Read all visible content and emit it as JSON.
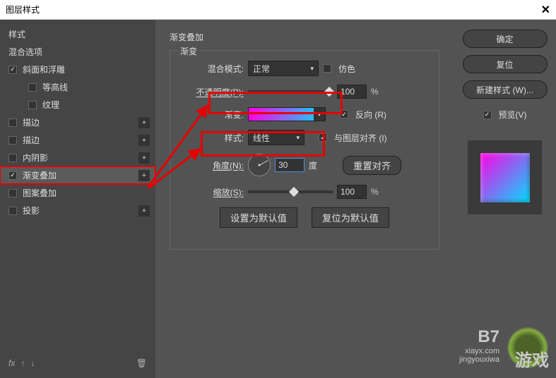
{
  "window": {
    "title": "图层样式"
  },
  "sidebar": {
    "style_label": "样式",
    "blend_options": "混合选项",
    "items": [
      {
        "label": "斜面和浮雕",
        "checked": true,
        "plus": false,
        "indent": false
      },
      {
        "label": "等高线",
        "checked": false,
        "plus": false,
        "indent": true
      },
      {
        "label": "纹理",
        "checked": false,
        "plus": false,
        "indent": true
      },
      {
        "label": "描边",
        "checked": false,
        "plus": true,
        "indent": false
      },
      {
        "label": "描边",
        "checked": false,
        "plus": true,
        "indent": false
      },
      {
        "label": "内阴影",
        "checked": false,
        "plus": true,
        "indent": false
      },
      {
        "label": "渐变叠加",
        "checked": true,
        "plus": true,
        "indent": false,
        "highlighted": true,
        "selected": true
      },
      {
        "label": "图案叠加",
        "checked": false,
        "plus": false,
        "indent": false
      },
      {
        "label": "投影",
        "checked": false,
        "plus": true,
        "indent": false
      }
    ],
    "footer_fx": "fx"
  },
  "panel": {
    "title": "渐变叠加",
    "legend": "渐变",
    "blend_mode_label": "混合模式:",
    "blend_mode_value": "正常",
    "dither_label": "仿色",
    "opacity_label": "不透明度(P):",
    "opacity_value": "100",
    "percent": "%",
    "gradient_label": "渐变:",
    "reverse_label": "反向 (R)",
    "style_label": "样式:",
    "style_value": "线性",
    "align_label": "与图层对齐 (I)",
    "angle_label": "角度(N):",
    "angle_value": "30",
    "angle_unit": "度",
    "reset_align": "重置对齐",
    "scale_label": "缩放(S):",
    "scale_value": "100",
    "set_default": "设置为默认值",
    "reset_default": "复位为默认值"
  },
  "right": {
    "ok": "确定",
    "reset": "复位",
    "new_style": "新建样式 (W)...",
    "preview_label": "预览(V)"
  },
  "watermark": {
    "url": "xiayx.com",
    "pinyin": "jingyouxiwa",
    "brand_prefix": "B7",
    "brand": "游戏"
  }
}
